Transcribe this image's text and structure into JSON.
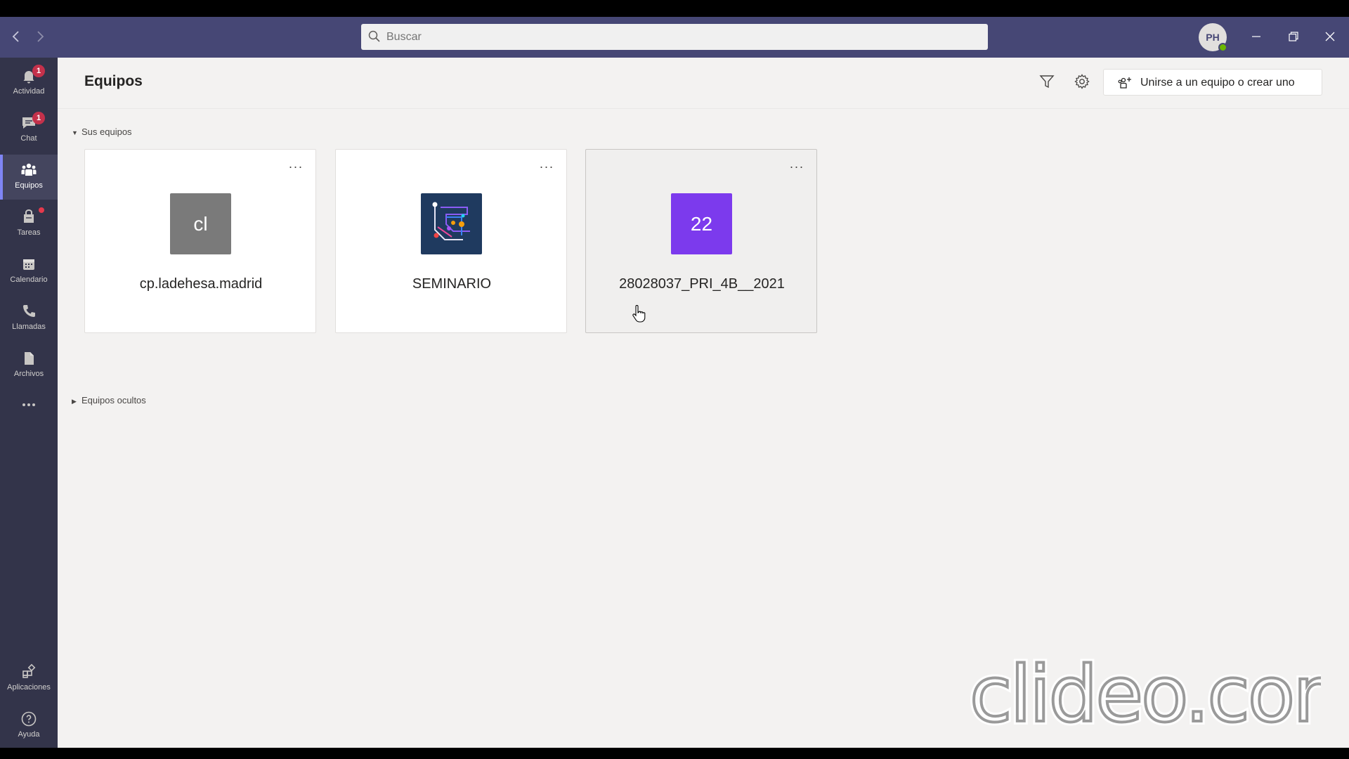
{
  "search": {
    "placeholder": "Buscar"
  },
  "user": {
    "initials": "PH"
  },
  "rail": [
    {
      "label": "Actividad",
      "badge": "1",
      "icon": "bell-icon"
    },
    {
      "label": "Chat",
      "badge": "1",
      "icon": "chat-icon"
    },
    {
      "label": "Equipos",
      "icon": "teams-icon",
      "active": true
    },
    {
      "label": "Tareas",
      "icon": "assignments-icon",
      "dot": true
    },
    {
      "label": "Calendario",
      "icon": "calendar-icon"
    },
    {
      "label": "Llamadas",
      "icon": "phone-icon"
    },
    {
      "label": "Archivos",
      "icon": "files-icon"
    },
    {
      "label": "Aplicaciones",
      "icon": "apps-icon"
    },
    {
      "label": "Ayuda",
      "icon": "help-icon"
    }
  ],
  "header": {
    "title": "Equipos",
    "join_label": "Unirse a un equipo o crear uno"
  },
  "sections": {
    "your_teams": "Sus equipos",
    "hidden_teams": "Equipos ocultos"
  },
  "teams": [
    {
      "name": "cp.ladehesa.madrid",
      "logo_text": "cl",
      "logo_color": "#7a7a7a"
    },
    {
      "name": "SEMINARIO",
      "logo_text": "",
      "logo_color": "#1f3a5f"
    },
    {
      "name": "28028037_PRI_4B__2021",
      "logo_text": "22",
      "logo_color": "#7c3aed"
    }
  ],
  "watermark": "clideo.com",
  "colors": {
    "titlebar": "#464775",
    "rail": "#33344a",
    "accent": "#7f85f5",
    "badge": "#c4314b"
  }
}
